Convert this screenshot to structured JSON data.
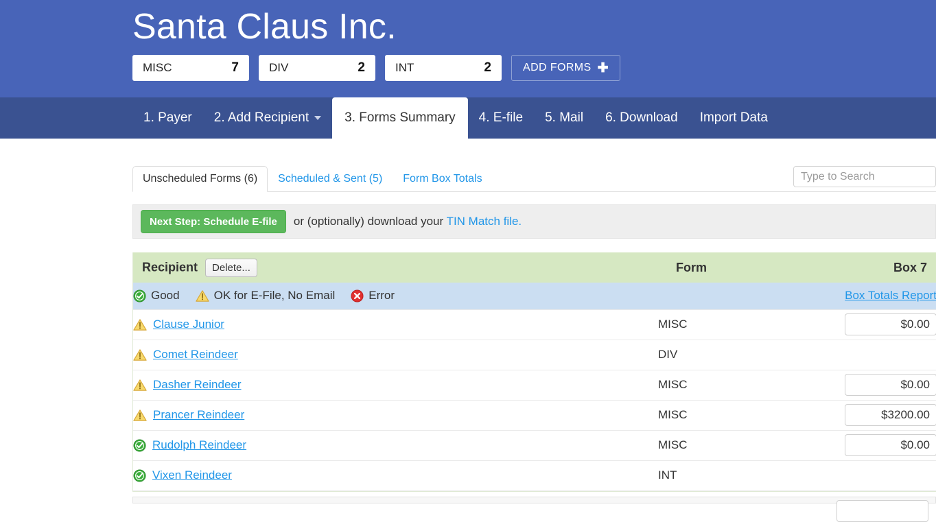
{
  "header": {
    "company_title": "Santa Claus Inc.",
    "form_badges": [
      {
        "label": "MISC",
        "count": "7"
      },
      {
        "label": "DIV",
        "count": "2"
      },
      {
        "label": "INT",
        "count": "2"
      }
    ],
    "add_forms_label": "ADD FORMS",
    "add_forms_plus": "✚",
    "background_color": "#4864b8"
  },
  "main_nav": {
    "background_color": "#3a5291",
    "items": [
      {
        "label": "1. Payer",
        "active": false,
        "has_caret": false
      },
      {
        "label": "2. Add Recipient",
        "active": false,
        "has_caret": true
      },
      {
        "label": "3. Forms Summary",
        "active": true,
        "has_caret": false
      },
      {
        "label": "4. E-file",
        "active": false,
        "has_caret": false
      },
      {
        "label": "5. Mail",
        "active": false,
        "has_caret": false
      },
      {
        "label": "6. Download",
        "active": false,
        "has_caret": false
      },
      {
        "label": "Import Data",
        "active": false,
        "has_caret": false
      }
    ]
  },
  "subtabs": [
    {
      "label": "Unscheduled Forms (6)",
      "active": true
    },
    {
      "label": "Scheduled & Sent (5)",
      "active": false
    },
    {
      "label": "Form Box Totals",
      "active": false
    }
  ],
  "search": {
    "placeholder": "Type to Search",
    "value": ""
  },
  "action_panel": {
    "next_step_label": "Next Step: Schedule E-file",
    "text_before_link": "or (optionally) download your ",
    "link_label": "TIN Match file.",
    "button_color": "#5cb85c",
    "link_color": "#2196e8"
  },
  "table": {
    "header_background": "#d6e8c2",
    "legend_background": "#cbdef2",
    "columns": {
      "recipient": "Recipient",
      "form": "Form",
      "box": "Box 7"
    },
    "delete_button_label": "Delete...",
    "legend": {
      "good_label": "Good",
      "warn_label": "OK for E-File, No Email",
      "error_label": "Error",
      "report_link": "Box Totals Report"
    },
    "rows": [
      {
        "status": "warning",
        "recipient": "Clause Junior",
        "form": "MISC",
        "box_value": "$0.00",
        "has_box_input": true
      },
      {
        "status": "warning",
        "recipient": "Comet Reindeer",
        "form": "DIV",
        "box_value": "",
        "has_box_input": false
      },
      {
        "status": "warning",
        "recipient": "Dasher Reindeer",
        "form": "MISC",
        "box_value": "$0.00",
        "has_box_input": true
      },
      {
        "status": "warning",
        "recipient": "Prancer Reindeer",
        "form": "MISC",
        "box_value": "$3200.00",
        "has_box_input": true
      },
      {
        "status": "good",
        "recipient": "Rudolph Reindeer",
        "form": "MISC",
        "box_value": "$0.00",
        "has_box_input": true
      },
      {
        "status": "good",
        "recipient": "Vixen Reindeer",
        "form": "INT",
        "box_value": "",
        "has_box_input": false
      }
    ]
  },
  "icon_names": {
    "good": "status-good-check-icon",
    "warning": "status-warning-triangle-icon",
    "error": "status-error-x-icon",
    "caret": "chevron-down-icon",
    "plus": "plus-icon"
  },
  "colors": {
    "link": "#2196e8",
    "good_green": "#3aad3a",
    "warn_amber": "#f0c04a",
    "error_red": "#e03030"
  }
}
